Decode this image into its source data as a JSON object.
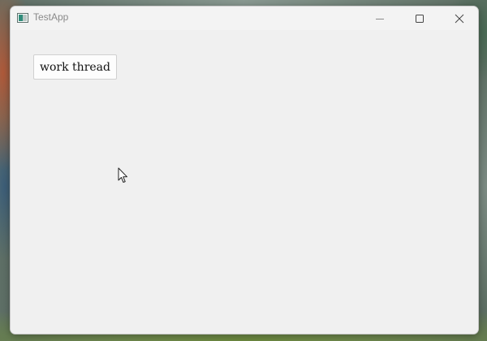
{
  "window": {
    "title": "TestApp",
    "icon": "app-window-icon",
    "controls": {
      "minimize_icon": "minimize-icon",
      "maximize_icon": "maximize-icon",
      "close_icon": "close-icon"
    }
  },
  "main": {
    "button_label": "work thread"
  },
  "cursor": {
    "icon": "mouse-pointer-icon"
  },
  "colors": {
    "window_background": "#f0f0f0",
    "button_background": "#fdfdfd",
    "button_border": "#d0d0d0",
    "title_text": "#8a8a8a"
  }
}
